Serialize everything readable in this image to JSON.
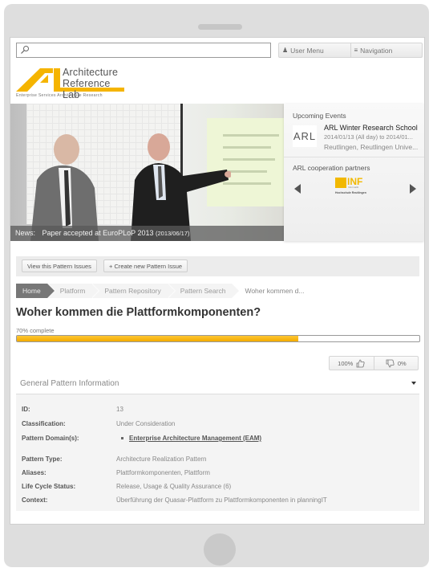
{
  "search": {
    "placeholder": "",
    "value": ""
  },
  "topnav": {
    "user_menu": "User Menu",
    "navigation": "Navigation"
  },
  "logo": {
    "line1": "Architecture",
    "line2": "Reference Lab",
    "tagline": "Enterprise Services Architecture Research",
    "brand_color": "#f5b400"
  },
  "news": {
    "label": "News:",
    "text": "Paper accepted at EuroPLoP 2013",
    "date": "(2013/06/17)"
  },
  "sidebar": {
    "events_heading": "Upcoming Events",
    "event": {
      "thumb": "ARL",
      "title": "ARL Winter Research School",
      "date": "2014/01/13 (All day) to 2014/01...",
      "location": "Reutlingen, Reutlingen Unive..."
    },
    "partners_heading": "ARL cooperation partners",
    "partner": {
      "name": "INF",
      "sub": "Informatik",
      "org": "Hochschule Reutlingen"
    }
  },
  "toolbar": {
    "view_issues": "View this Pattern Issues",
    "create_issue": "+ Create new Pattern Issue"
  },
  "breadcrumb": [
    "Home",
    "Platform",
    "Pattern Repository",
    "Pattern Search",
    "Woher kommen d..."
  ],
  "page": {
    "title": "Woher kommen die Plattformkomponenten?",
    "progress_label": "70% complete",
    "progress_percent": 70
  },
  "votes": {
    "up": "100%",
    "down": "0%"
  },
  "section": {
    "title": "General Pattern Information",
    "rows": [
      {
        "key": "ID:",
        "value": "13"
      },
      {
        "key": "Classification:",
        "value": "Under Consideration"
      },
      {
        "key": "Pattern Domain(s):",
        "value": "Enterprise Architecture Management (EAM)"
      },
      {
        "key": "Pattern Type:",
        "value": "Architecture Realization Pattern"
      },
      {
        "key": "Aliases:",
        "value": "Plattformkomponenten, Plattform"
      },
      {
        "key": "Life Cycle Status:",
        "value": "Release, Usage & Quality Assurance (6)"
      },
      {
        "key": "Context:",
        "value": "Überführung der Quasar-Plattform zu Plattformkomponenten in planningIT"
      }
    ]
  },
  "colors": {
    "accent": "#f5b400",
    "breadcrumb_home": "#777777"
  }
}
